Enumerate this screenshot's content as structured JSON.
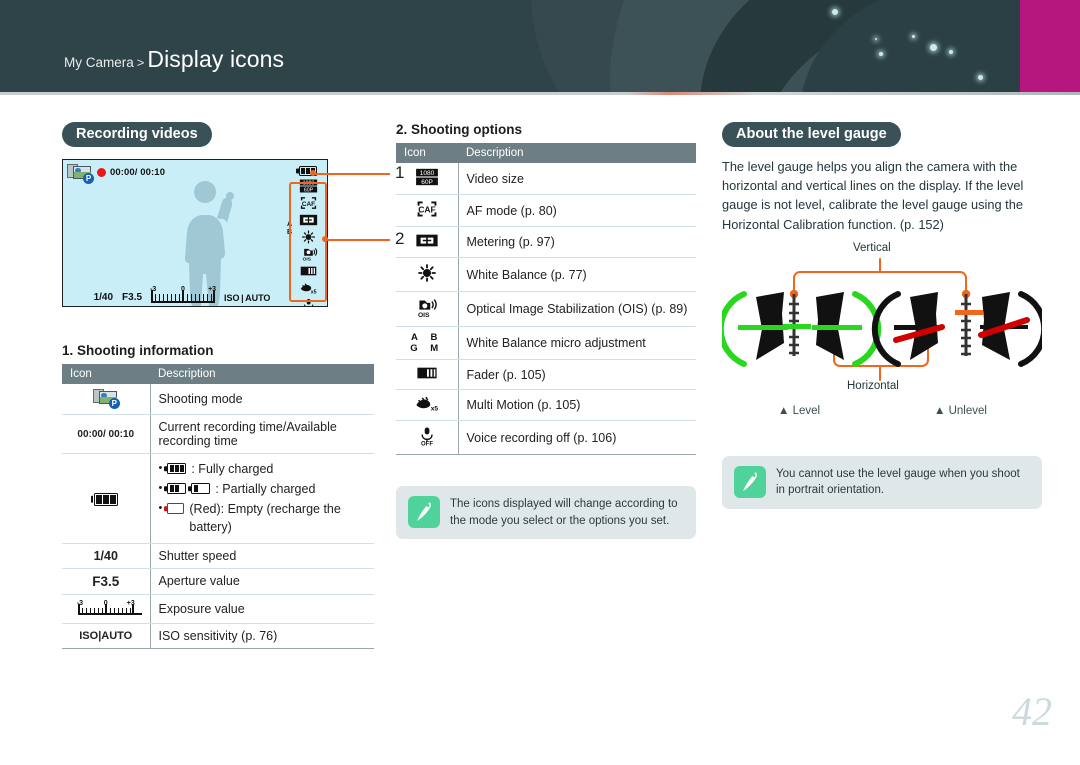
{
  "header": {
    "breadcrumb_parent": "My Camera",
    "breadcrumb_separator": ">",
    "title": "Display icons",
    "bg_color": "#2f4449",
    "accent_color": "#b5177f"
  },
  "left_column": {
    "pill_title": "Recording videos",
    "preview": {
      "rec_time": "00:00/ 00:10",
      "shutter": "1/40",
      "aperture": "F3.5",
      "ev_minus": "-3",
      "ev_zero": "0",
      "ev_plus": "+3",
      "iso_label": "ISO",
      "iso_value": "AUTO",
      "wb_a": "A",
      "wb_b": "B",
      "callout_1": "1",
      "callout_2": "2",
      "callout_color": "#f0661c",
      "bg_color": "#c9eef8"
    },
    "table": {
      "title": "1. Shooting information",
      "headers": [
        "Icon",
        "Description"
      ],
      "rows": [
        {
          "icon": "shooting-mode-icon",
          "desc": "Shooting mode"
        },
        {
          "icon": "00:00/ 00:10",
          "desc": "Current recording time/Available recording time"
        },
        {
          "icon": "battery-icon",
          "desc_bullets": [
            ": Fully charged",
            ": Partially charged",
            "(Red): Empty (recharge the battery)"
          ]
        },
        {
          "icon": "1/40",
          "desc": "Shutter speed"
        },
        {
          "icon": "F3.5",
          "desc": "Aperture value"
        },
        {
          "icon": "exposure-scale-icon",
          "desc": "Exposure value"
        },
        {
          "icon": "ISO|AUTO",
          "desc": "ISO sensitivity (p. 76)"
        }
      ]
    }
  },
  "middle_column": {
    "table": {
      "title": "2. Shooting options",
      "headers": [
        "Icon",
        "Description"
      ],
      "rows": [
        {
          "icon": "video-size-icon",
          "icon_text_top": "1080",
          "icon_text_bottom": "60P",
          "desc": "Video size"
        },
        {
          "icon": "af-mode-icon",
          "icon_text": "CAF",
          "desc": "AF mode (p. 80)"
        },
        {
          "icon": "metering-icon",
          "desc": "Metering (p. 97)"
        },
        {
          "icon": "white-balance-sun-icon",
          "desc": "White Balance (p. 77)"
        },
        {
          "icon": "ois-icon",
          "icon_text": "OIS",
          "desc": "Optical Image Stabilization (OIS) (p. 89)"
        },
        {
          "icon": "wb-micro-adjust-icon",
          "icon_text": "A B G M",
          "desc": "White Balance micro adjustment"
        },
        {
          "icon": "fader-icon",
          "desc": "Fader (p. 105)"
        },
        {
          "icon": "multi-motion-icon",
          "icon_text": "x5",
          "desc": "Multi Motion (p. 105)"
        },
        {
          "icon": "voice-recording-off-icon",
          "icon_text": "OFF",
          "desc": "Voice recording off (p. 106)"
        }
      ]
    },
    "note": "The icons displayed will change according to the mode you select or the options you set."
  },
  "right_column": {
    "pill_title": "About the level gauge",
    "body": "The level gauge helps you align the camera with the horizontal and vertical lines on the display. If the level gauge is not level, calibrate the level gauge using the Horizontal Calibration function. (p. 152)",
    "gauge": {
      "vertical_label": "Vertical",
      "horizontal_label": "Horizontal",
      "level_caption": "▲ Level",
      "unlevel_caption": "▲ Unlevel",
      "level_color": "#2ad71f",
      "unlevel_color": "#d00000",
      "pointer_color": "#f0661c"
    },
    "note": "You cannot use the level gauge when you shoot in portrait orientation."
  },
  "footer": {
    "page_number": "42"
  }
}
